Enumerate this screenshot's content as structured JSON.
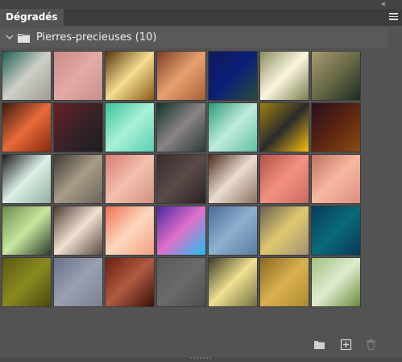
{
  "panel": {
    "tab_label": "Dégradés",
    "collapse_glyph": "«",
    "menu_icon": "hamburger-icon"
  },
  "group": {
    "label": "Pierres-precieuses (10)",
    "expanded": true,
    "icon": "folder-icon"
  },
  "swatches": [
    [
      "#1f5e52",
      "#cfcfc7",
      "#9e9c94"
    ],
    [
      "#c98a86",
      "#e4aaa6",
      "#c5908c"
    ],
    [
      "#5a3510",
      "#f4dd90",
      "#8a5a1a"
    ],
    [
      "#7a4028",
      "#e8a070",
      "#a8603a"
    ],
    [
      "#101a5a",
      "#0a1f78",
      "#2a4a3a"
    ],
    [
      "#8a8c60",
      "#fbf7e0",
      "#7a7c50"
    ],
    [
      "#a89a70",
      "#6a6a48",
      "#1a2c20"
    ],
    [
      "#3a1a10",
      "#e86a3a",
      "#8a2a10"
    ],
    [
      "#6a1e26",
      "#3a2228",
      "#1a1e22"
    ],
    [
      "#3ac49a",
      "#a8f0d8",
      "#5ad0b0"
    ],
    [
      "#123228",
      "#8a8484",
      "#2a3a34"
    ],
    [
      "#2a9a78",
      "#c0ecdc",
      "#60c0a0"
    ],
    [
      "#a08010",
      "#2a2a2a",
      "#f8c010"
    ],
    [
      "#2a0e1e",
      "#5a2410",
      "#8a4a12"
    ],
    [
      "#1a1a1a",
      "#dcefe6",
      "#90b0a0"
    ],
    [
      "#3e3a34",
      "#a89c88",
      "#6a6458"
    ],
    [
      "#d87c70",
      "#f4c0b0",
      "#d09080"
    ],
    [
      "#3a2a2a",
      "#5a4a48",
      "#2a2224"
    ],
    [
      "#4a2a1a",
      "#eadcd0",
      "#8a7060"
    ],
    [
      "#b05048",
      "#f49080",
      "#c86a60"
    ],
    [
      "#c07060",
      "#f8b8a0",
      "#d89080"
    ],
    [
      "#6a8a4a",
      "#c8e8a0",
      "#2a3a2a"
    ],
    [
      "#4a3a34",
      "#f0e0d0",
      "#5a4a40"
    ],
    [
      "#f07050",
      "#fcd8c0",
      "#f4a080"
    ],
    [
      "#4a2aa0",
      "#e070c8",
      "#20c0f0"
    ],
    [
      "#4a6a9a",
      "#90b0d0",
      "#5a7aa0"
    ],
    [
      "#6a6050",
      "#e0c870",
      "#a09070"
    ],
    [
      "#0a3a5a",
      "#0a6a7a",
      "#083858"
    ],
    [
      "#5a5a10",
      "#8a8a20",
      "#4a4a10"
    ],
    [
      "#6a7088",
      "#9aa0b0",
      "#7a8090"
    ],
    [
      "#6a2010",
      "#b05a40",
      "#3a1008"
    ],
    [
      "#5a5a58",
      "#6a6a68",
      "#4e4e4c"
    ],
    [
      "#3a3a28",
      "#f0e090",
      "#707040"
    ],
    [
      "#8a6a20",
      "#d8b050",
      "#b08a30"
    ],
    [
      "#a0c080",
      "#e0ecd0",
      "#6a8a3a"
    ]
  ],
  "footer": {
    "new_group_icon": "folder-icon",
    "new_gradient_icon": "plus-square-icon",
    "delete_icon": "trash-icon"
  }
}
